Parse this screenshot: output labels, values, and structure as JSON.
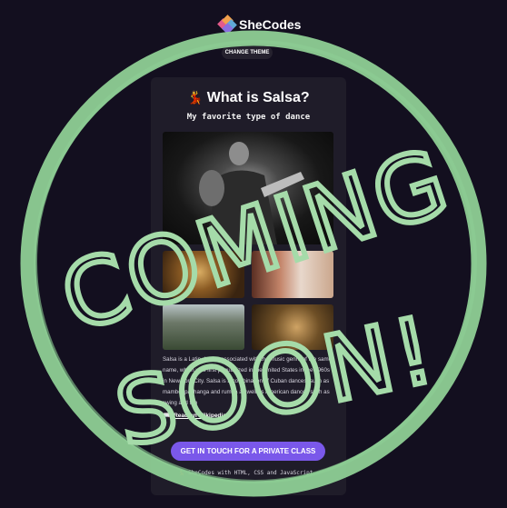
{
  "header": {
    "brand": "SheCodes",
    "theme_button": "CHANGE THEME"
  },
  "card": {
    "title_emoji": "💃",
    "title": "What is Salsa?",
    "subtitle": "My favorite type of dance",
    "description": "Salsa is a Latin dance, associated with the music genre of the same name, which was first popularized in the United States in the 1960s in New York City. Salsa is a combination of Cuban dances, such as mambo, pachanga and rumba as well as American dances such as swing and tap",
    "wiki_link": "Read on Wikipedia",
    "cta_label": "GET IN TOUCH FOR A PRIVATE CLASS",
    "footer": "💃 SheCodes with HTML, CSS and JavaScript"
  },
  "overlay": {
    "line1": "COMING",
    "line2": "SOON!",
    "ring_color": "#8ecf95"
  },
  "colors": {
    "background": "#130f1f",
    "card": "#1f1c29",
    "accent": "#7a58ea"
  }
}
